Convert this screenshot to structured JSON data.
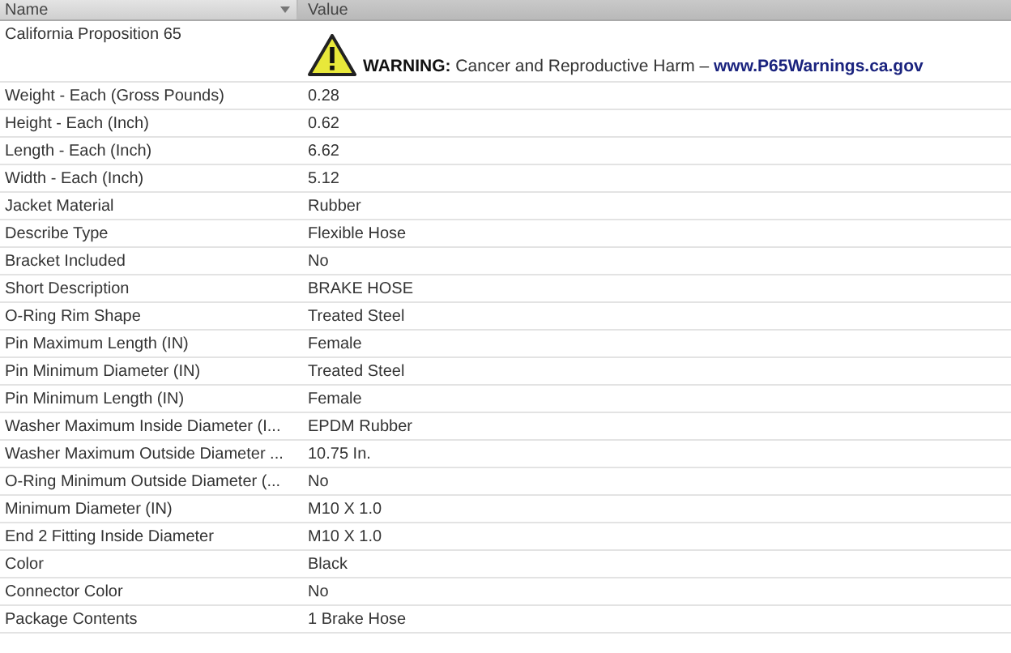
{
  "table": {
    "columns": [
      {
        "label": "Name",
        "sort_arrow": true,
        "selected": false
      },
      {
        "label": "Value",
        "sort_arrow": false,
        "selected": true
      }
    ],
    "warning": {
      "name": "California Proposition 65",
      "label": "WARNING:",
      "text": "Cancer and Reproductive Harm –",
      "link": "www.P65Warnings.ca.gov"
    },
    "rows": [
      {
        "name": "Weight - Each (Gross Pounds)",
        "value": "0.28"
      },
      {
        "name": "Height - Each (Inch)",
        "value": "0.62"
      },
      {
        "name": "Length - Each (Inch)",
        "value": "6.62"
      },
      {
        "name": "Width - Each (Inch)",
        "value": "5.12"
      },
      {
        "name": "Jacket Material",
        "value": "Rubber"
      },
      {
        "name": "Describe Type",
        "value": "Flexible Hose"
      },
      {
        "name": "Bracket Included",
        "value": "No"
      },
      {
        "name": "Short Description",
        "value": "BRAKE HOSE"
      },
      {
        "name": "O-Ring Rim Shape",
        "value": "Treated Steel"
      },
      {
        "name": "Pin Maximum Length (IN)",
        "value": "Female"
      },
      {
        "name": "Pin Minimum Diameter (IN)",
        "value": "Treated Steel"
      },
      {
        "name": "Pin Minimum Length (IN)",
        "value": "Female"
      },
      {
        "name": "Washer Maximum Inside Diameter (I...",
        "value": "EPDM Rubber"
      },
      {
        "name": "Washer Maximum Outside Diameter ...",
        "value": "10.75 In."
      },
      {
        "name": "O-Ring Minimum Outside Diameter (...",
        "value": "No"
      },
      {
        "name": "Minimum Diameter (IN)",
        "value": "M10 X 1.0"
      },
      {
        "name": "End 2 Fitting Inside Diameter",
        "value": "M10 X 1.0"
      },
      {
        "name": "Color",
        "value": "Black"
      },
      {
        "name": "Connector Color",
        "value": "No"
      },
      {
        "name": "Package Contents",
        "value": "1 Brake Hose"
      }
    ]
  }
}
